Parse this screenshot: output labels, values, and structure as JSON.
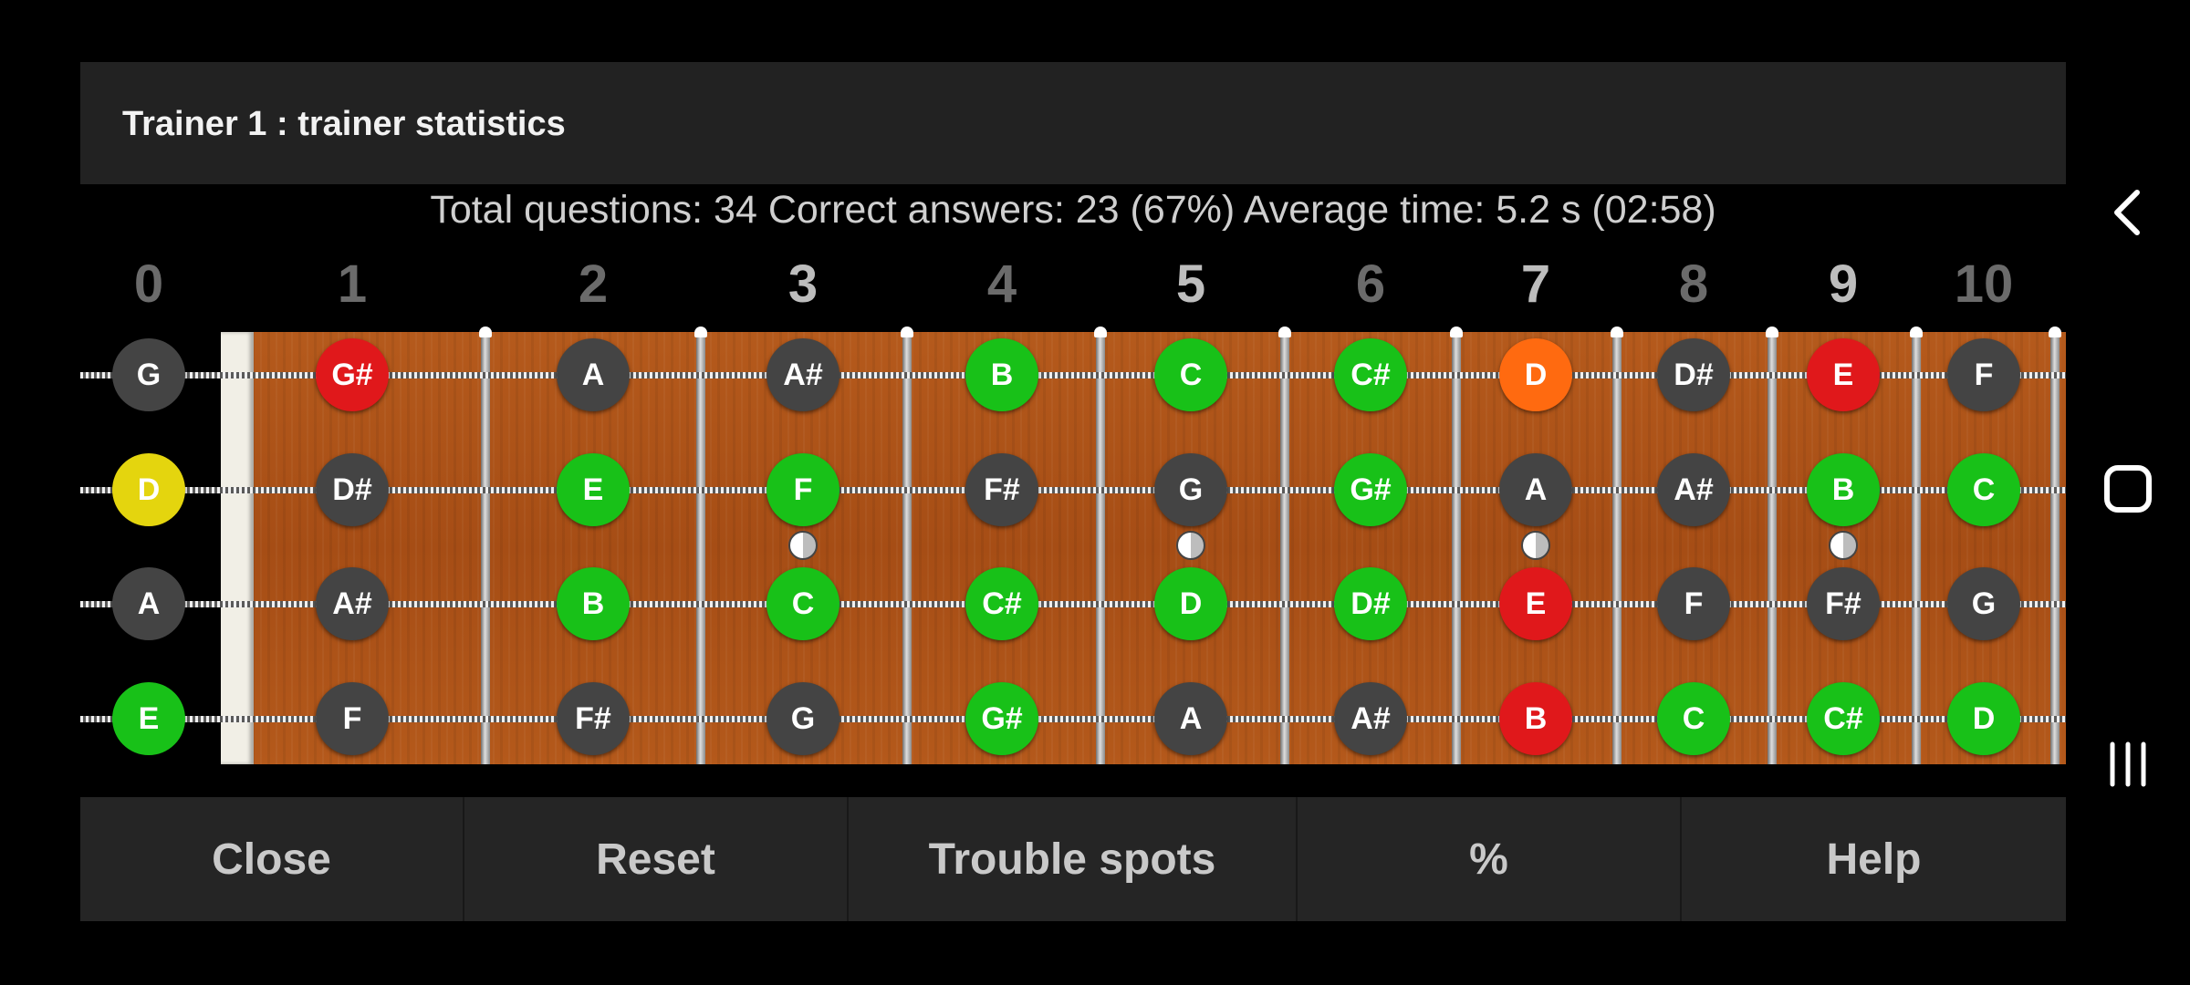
{
  "dialog": {
    "title": "Trainer 1 : trainer statistics"
  },
  "stats_text": "Total questions: 34 Correct answers: 23 (67%) Average time: 5.2 s (02:58)",
  "fret_numbers": [
    "0",
    "1",
    "2",
    "3",
    "4",
    "5",
    "6",
    "7",
    "8",
    "9",
    "10"
  ],
  "marked_frets": [
    3,
    5,
    7,
    9
  ],
  "strings": [
    {
      "notes": [
        {
          "label": "G",
          "status": "default"
        },
        {
          "label": "G#",
          "status": "wrong"
        },
        {
          "label": "A",
          "status": "default"
        },
        {
          "label": "A#",
          "status": "default"
        },
        {
          "label": "B",
          "status": "correct"
        },
        {
          "label": "C",
          "status": "correct"
        },
        {
          "label": "C#",
          "status": "correct"
        },
        {
          "label": "D",
          "status": "slow"
        },
        {
          "label": "D#",
          "status": "default"
        },
        {
          "label": "E",
          "status": "wrong"
        },
        {
          "label": "F",
          "status": "default"
        }
      ]
    },
    {
      "notes": [
        {
          "label": "D",
          "status": "selected"
        },
        {
          "label": "D#",
          "status": "default"
        },
        {
          "label": "E",
          "status": "correct"
        },
        {
          "label": "F",
          "status": "correct"
        },
        {
          "label": "F#",
          "status": "default"
        },
        {
          "label": "G",
          "status": "default"
        },
        {
          "label": "G#",
          "status": "correct"
        },
        {
          "label": "A",
          "status": "default"
        },
        {
          "label": "A#",
          "status": "default"
        },
        {
          "label": "B",
          "status": "correct"
        },
        {
          "label": "C",
          "status": "correct"
        }
      ]
    },
    {
      "notes": [
        {
          "label": "A",
          "status": "default"
        },
        {
          "label": "A#",
          "status": "default"
        },
        {
          "label": "B",
          "status": "correct"
        },
        {
          "label": "C",
          "status": "correct"
        },
        {
          "label": "C#",
          "status": "correct"
        },
        {
          "label": "D",
          "status": "correct"
        },
        {
          "label": "D#",
          "status": "correct"
        },
        {
          "label": "E",
          "status": "wrong"
        },
        {
          "label": "F",
          "status": "default"
        },
        {
          "label": "F#",
          "status": "default"
        },
        {
          "label": "G",
          "status": "default"
        }
      ]
    },
    {
      "notes": [
        {
          "label": "E",
          "status": "correct"
        },
        {
          "label": "F",
          "status": "default"
        },
        {
          "label": "F#",
          "status": "default"
        },
        {
          "label": "G",
          "status": "default"
        },
        {
          "label": "G#",
          "status": "correct"
        },
        {
          "label": "A",
          "status": "default"
        },
        {
          "label": "A#",
          "status": "default"
        },
        {
          "label": "B",
          "status": "wrong"
        },
        {
          "label": "C",
          "status": "correct"
        },
        {
          "label": "C#",
          "status": "correct"
        },
        {
          "label": "D",
          "status": "correct"
        }
      ]
    }
  ],
  "status_colors": {
    "default": "#444444",
    "correct": "#18c118",
    "wrong": "#e0181b",
    "slow": "#ff6a10",
    "selected": "#e4d50e"
  },
  "buttons": {
    "close": "Close",
    "reset": "Reset",
    "trouble_spots": "Trouble spots",
    "percent": "%",
    "help": "Help"
  },
  "system_nav": {
    "back_icon": "chevron-left-icon",
    "home_icon": "rounded-square-icon",
    "recents_icon": "three-bars-icon"
  }
}
